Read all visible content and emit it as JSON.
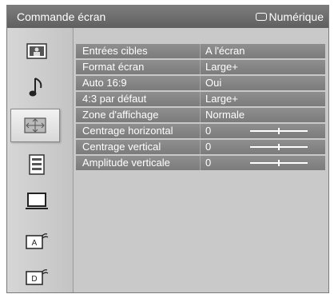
{
  "header": {
    "title": "Commande écran",
    "source_label": "Numérique"
  },
  "sidebar": {
    "items": [
      {
        "name": "picture-icon",
        "selected": false
      },
      {
        "name": "sound-note-icon",
        "selected": false
      },
      {
        "name": "screen-control-icon",
        "selected": true
      },
      {
        "name": "features-list-icon",
        "selected": false
      },
      {
        "name": "tv-monitor-icon",
        "selected": false
      },
      {
        "name": "analog-setup-icon",
        "label": "A",
        "selected": false
      },
      {
        "name": "digital-setup-icon",
        "label": "D",
        "selected": false
      }
    ]
  },
  "settings": [
    {
      "label": "Entrées cibles",
      "value": "A l'écran"
    },
    {
      "label": "Format écran",
      "value": "Large+"
    },
    {
      "label": "Auto 16:9",
      "value": "Oui"
    },
    {
      "label": "4:3 par défaut",
      "value": "Large+"
    },
    {
      "label": "Zone d'affichage",
      "value": "Normale"
    },
    {
      "label": "Centrage horizontal",
      "value": "0",
      "slider_fraction": 0.5
    },
    {
      "label": "Centrage vertical",
      "value": "0",
      "slider_fraction": 0.5
    },
    {
      "label": "Amplitude verticale",
      "value": "0",
      "slider_fraction": 0.5
    }
  ]
}
